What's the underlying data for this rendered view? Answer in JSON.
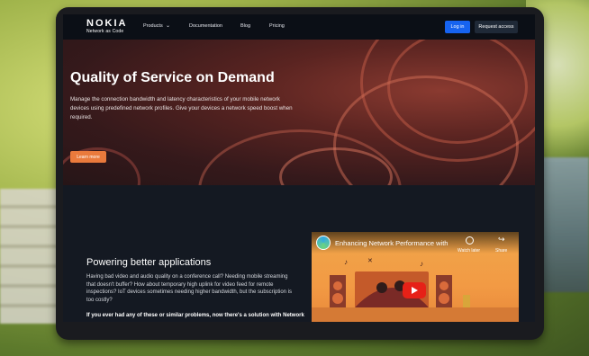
{
  "brand": {
    "logo": "NOKIA",
    "subtitle": "Network as Code"
  },
  "nav": {
    "items": [
      "Products",
      "Documentation",
      "Blog",
      "Pricing"
    ],
    "login": "Log in",
    "request": "Request access"
  },
  "hero": {
    "title": "Quality of Service on Demand",
    "description": "Manage the connection bandwidth and latency characteristics of your mobile network devices using predefined network profiles. Give your devices a network speed boost when required.",
    "cta": "Learn more"
  },
  "section": {
    "title": "Powering better applications",
    "text": "Having bad video and audio quality on a conference call? Needing mobile streaming that doesn't buffer? How about temporary high uplink for video feed for remote inspections? IoT devices sometimes needing higher bandwidth, but the subscription is too costly?",
    "bold": "If you ever had any of these or similar problems, now there's a solution with Network"
  },
  "video": {
    "title": "Enhancing Network Performance with",
    "watch_later": "Watch later",
    "share": "Share"
  },
  "colors": {
    "accent": "#ea7a3c",
    "primary": "#1663f0",
    "nav_bg": "#0b0f16",
    "play": "#e62117"
  }
}
